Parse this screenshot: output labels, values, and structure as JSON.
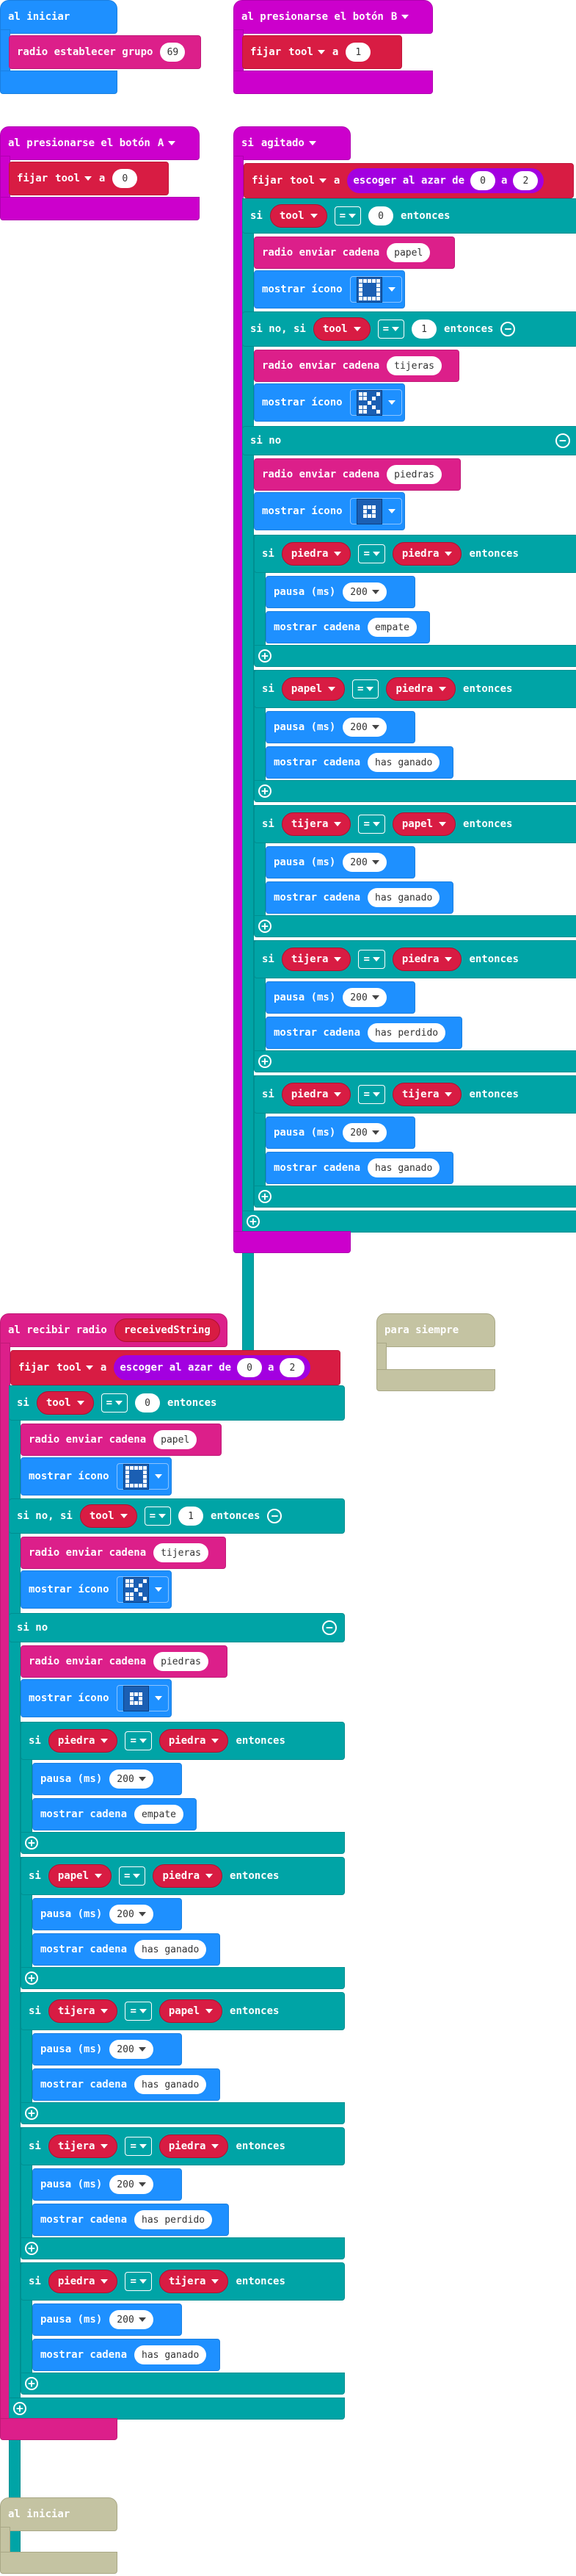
{
  "events": {
    "on_start_label": "al iniciar",
    "button_b_label": "al presionarse el botón",
    "button_b_value": "B",
    "button_a_label": "al presionarse el botón",
    "button_a_value": "A",
    "shake_label": "si",
    "shake_value": "agitado",
    "radio_receive_label": "al recibir radio",
    "radio_receive_param": "receivedString",
    "forever_label": "para siempre",
    "on_start2_label": "al iniciar"
  },
  "blocks": {
    "radio_set_group_label": "radio establecer grupo",
    "radio_group_value": "69",
    "set_label": "fijar",
    "to_label": "a",
    "var_tool": "tool",
    "var_piedra": "piedra",
    "var_papel": "papel",
    "var_tijera": "tijera",
    "value_1": "1",
    "value_0": "0",
    "value_2": "2",
    "random_label": "escoger al azar de",
    "random_to": "a",
    "if_label": "si",
    "else_if_label": "si no, si",
    "else_label": "si no",
    "then_label": "entonces",
    "eq_op": "=",
    "radio_send_string_label": "radio enviar cadena",
    "show_icon_label": "mostrar ícono",
    "pause_label": "pausa (ms)",
    "pause_value": "200",
    "show_string_label": "mostrar cadena",
    "str_papel": "papel",
    "str_tijeras": "tijeras",
    "str_piedras": "piedras",
    "str_empate": "empate",
    "str_ganado": "has ganado",
    "str_perdido": "has perdido",
    "plus_icon": "plus-icon",
    "minus_icon": "minus-icon"
  },
  "colors": {
    "basic": "#1e90ff",
    "radio": "#dc1f8a",
    "input": "#cc00cc",
    "variables": "#d81c43",
    "logic": "#00a4a6",
    "math": "#a300e0",
    "disabled": "#c4c3a2"
  }
}
